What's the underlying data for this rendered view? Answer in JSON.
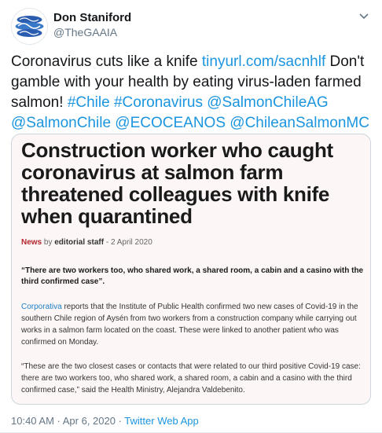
{
  "author": {
    "display_name": "Don Staniford",
    "handle": "@TheGAAIA"
  },
  "tweet": {
    "text_1": "Coronavirus cuts like a knife ",
    "link_1": "tinyurl.com/sacnhlf",
    "text_2": " Don't gamble with your health by eating virus-laden farmed salmon! ",
    "tag_chile": "#Chile",
    "tag_corona": "#Coronavirus",
    "mention_1": "@SalmonChileAG",
    "mention_2": "@SalmonChile",
    "mention_3": "@ECOCEANOS",
    "mention_4": "@ChileanSalmonMC"
  },
  "article": {
    "headline": "Construction worker who caught coronavirus at salmon farm threatened colleagues with knife when quarantined",
    "category": "News",
    "by": " by ",
    "author": "editorial staff",
    "date_sep": " - ",
    "date": "2 April 2020",
    "quote": "“There are two workers too, who shared work, a shared room, a cabin and a casino with the third confirmed case”.",
    "para1_source": "Corporativa",
    "para1_text": " reports that the Institute of Public Health confirmed two new cases of Covid-19 in the southern Chile region of Aysén from two workers from a construction company while carrying out works in a salmon farm located on the coast. These were linked to another patient who was confirmed on Monday.",
    "para2": "“These are the two closest cases or contacts that were related to our third positive Covid-19 case: there are two workers too, who shared work, a shared room, a cabin and a casino with the third confirmed case,” said the Health Ministry, Alejandra Valdebenito."
  },
  "footer": {
    "timestamp": "10:40 AM · Apr 6, 2020 · ",
    "app": "Twitter Web App"
  },
  "colors": {
    "link": "#1b95e0",
    "card_bg": "#fdf6f6",
    "category": "#b3262d"
  },
  "icons": {
    "avatar": "gaaia-logo",
    "caret": "chevron-down-icon"
  }
}
